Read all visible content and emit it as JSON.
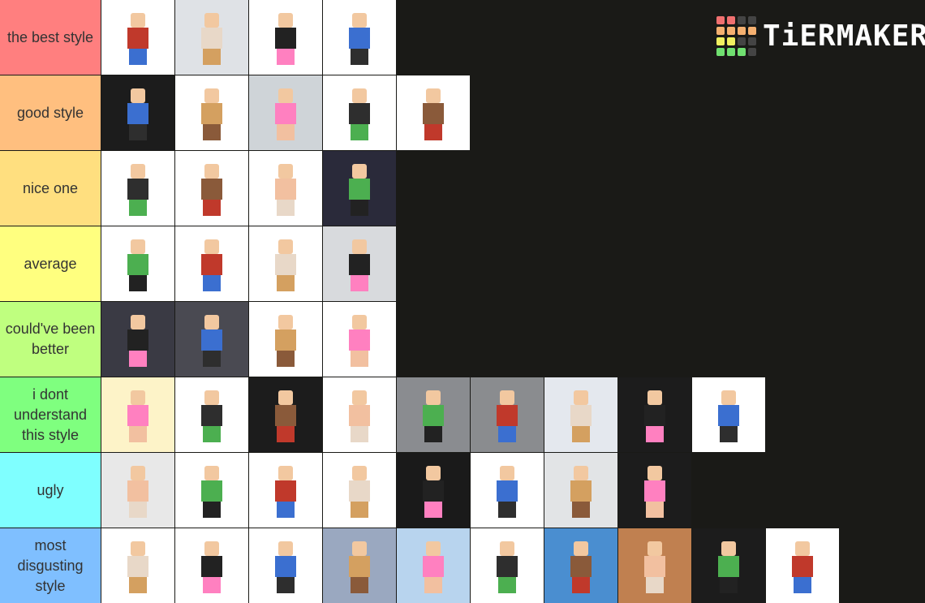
{
  "logo": {
    "text": "TiERMAKER",
    "grid": [
      [
        "#f07070",
        "#f07070",
        "#444444",
        "#444444"
      ],
      [
        "#f5b070",
        "#f5b070",
        "#f5b070",
        "#f5b070"
      ],
      [
        "#f0f060",
        "#f0f060",
        "#444444",
        "#444444"
      ],
      [
        "#70e070",
        "#70e070",
        "#70e070",
        "#444444"
      ]
    ]
  },
  "tiers": [
    {
      "label": "the best style",
      "color": "#ff7f7f",
      "tiles": [
        "#ffffff",
        "#dfe2e6",
        "#ffffff",
        "#ffffff"
      ]
    },
    {
      "label": "good style",
      "color": "#ffbf7f",
      "tiles": [
        "#1c1c1c",
        "#ffffff",
        "#cfd4d8",
        "#ffffff",
        "#ffffff"
      ]
    },
    {
      "label": "nice one",
      "color": "#ffdf7f",
      "tiles": [
        "#ffffff",
        "#ffffff",
        "#ffffff",
        "#2a2a3a"
      ]
    },
    {
      "label": "average",
      "color": "#ffff7f",
      "tiles": [
        "#ffffff",
        "#ffffff",
        "#ffffff",
        "#d8dadd"
      ]
    },
    {
      "label": "could've been better",
      "color": "#bfff7f",
      "tiles": [
        "#3a3a44",
        "#4a4a52",
        "#ffffff",
        "#ffffff"
      ]
    },
    {
      "label": "i dont understand this style",
      "color": "#7fff7f",
      "tiles": [
        "#fdf3c8",
        "#ffffff",
        "#1c1c1c",
        "#ffffff",
        "#8a8c90",
        "#8a8c8f",
        "#e4e8ee",
        "#1c1c1c",
        "#ffffff"
      ]
    },
    {
      "label": "ugly",
      "color": "#7fffff",
      "tiles": [
        "#e8e8e8",
        "#ffffff",
        "#ffffff",
        "#ffffff",
        "#1a1a1a",
        "#ffffff",
        "#e2e4e6",
        "#1c1c1c"
      ]
    },
    {
      "label": "most disgusting style",
      "color": "#7fbfff",
      "tiles": [
        "#ffffff",
        "#ffffff",
        "#ffffff",
        "#9aa8c0",
        "#b8d4ee",
        "#ffffff",
        "#4a8ed0",
        "#c08050",
        "#1c1c1c",
        "#ffffff"
      ]
    }
  ],
  "figure_colors": [
    "#c0392b",
    "#e8d8c8",
    "#222222",
    "#3b6fd0",
    "#d4a060",
    "#ff80c0",
    "#2e2e2e",
    "#8a5a3a",
    "#f2c0a0",
    "#4caf50"
  ]
}
